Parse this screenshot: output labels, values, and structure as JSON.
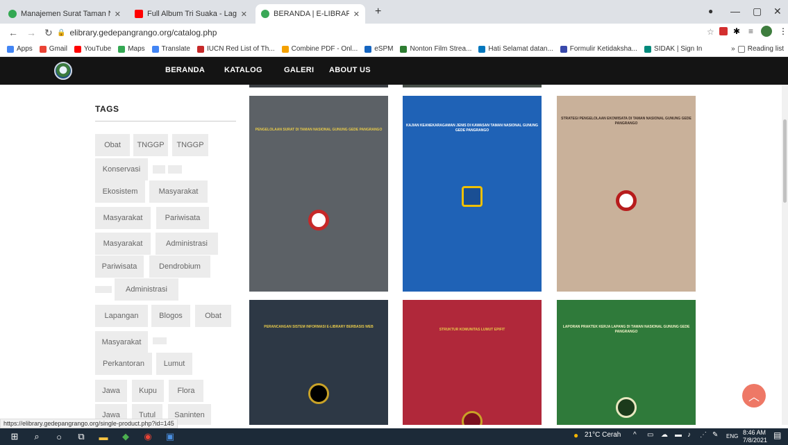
{
  "browser": {
    "tabs": [
      {
        "title": "Manajemen Surat Taman Nasion...",
        "color": "#33a852",
        "active": false
      },
      {
        "title": "Full Album Tri Suaka - Lagu...",
        "color": "#ff0000",
        "active": false
      },
      {
        "title": "BERANDA | E-LIBRARY",
        "color": "#3aa857",
        "active": true
      }
    ],
    "url": "elibrary.gedepangrango.org/catalog.php",
    "bookmarks": [
      {
        "label": "Apps",
        "color": "#4285f4"
      },
      {
        "label": "Gmail",
        "color": "#ea4335"
      },
      {
        "label": "YouTube",
        "color": "#ff0000"
      },
      {
        "label": "Maps",
        "color": "#34a853"
      },
      {
        "label": "Translate",
        "color": "#4285f4"
      },
      {
        "label": "IUCN Red List of Th...",
        "color": "#c62828"
      },
      {
        "label": "Combine PDF - Onl...",
        "color": "#f4a100"
      },
      {
        "label": "eSPM",
        "color": "#1565c0"
      },
      {
        "label": "Nonton Film Strea...",
        "color": "#2e7d32"
      },
      {
        "label": "Hati Selamat datan...",
        "color": "#0277bd"
      },
      {
        "label": "Formulir Ketidaksha...",
        "color": "#3949ab"
      },
      {
        "label": "SIDAK | Sign In",
        "color": "#00897b"
      }
    ],
    "reading_list": "Reading list"
  },
  "site": {
    "nav": [
      "BERANDA",
      "KATALOG",
      "GALERI",
      "ABOUT US"
    ]
  },
  "sidebar": {
    "title": "TAGS",
    "tags": [
      "Obat",
      "TNGGP",
      "TNGGP",
      "Konservasi",
      "",
      "",
      "Ekosistem",
      "Masyarakat",
      "Masyarakat",
      "Pariwisata",
      "Masyarakat",
      "Administrasi",
      "Pariwisata",
      "Dendrobium",
      "",
      "Administrasi",
      "Lapangan",
      "Blogos",
      "Obat",
      "Masyarakat",
      "",
      "Perkantoran",
      "Lumut",
      "Jawa",
      "Kupu",
      "Flora",
      "Jawa",
      "Tutul",
      "Saninten"
    ]
  },
  "books": [
    {
      "color": "#5c6166",
      "text": "PENGELOLAAN SURAT DI TAMAN NASIONAL GUNUNG GEDE PANGRANGO",
      "seal_color": "#c62828"
    },
    {
      "color": "#1f62b6",
      "text": "KAJIAN KEANEKARAGAMAN JENIS DI KAWASAN TAMAN NASIONAL GUNUNG GEDE PANGRANGO",
      "seal_color": "#f0c000"
    },
    {
      "color": "#c9b19a",
      "text": "STRATEGI PENGELOLAAN EKOWISATA DI TAMAN NASIONAL GUNUNG GEDE PANGRANGO",
      "seal_color": "#b71c1c"
    },
    {
      "color": "#2d3845",
      "text": "PERANCANGAN SISTEM INFORMASI E-LIBRARY BERBASIS WEB",
      "seal_color": "#c9a227"
    },
    {
      "color": "#b0283a",
      "text": "STRUKTUR KOMUNITAS LUMUT EPIFIT",
      "seal_color": "#c9a227"
    },
    {
      "color": "#2f7a3a",
      "text": "LAPORAN PRAKTEK KERJA LAPANG DI TAMAN NASIONAL GUNUNG GEDE PANGRANGO",
      "seal_color": "#1b3a1b"
    }
  ],
  "status_url": "https://elibrary.gedepangrango.org/single-product.php?id=145",
  "taskbar": {
    "weather": "21°C Cerah",
    "lang": "ENG",
    "time": "8:46 AM",
    "date": "7/8/2021"
  }
}
